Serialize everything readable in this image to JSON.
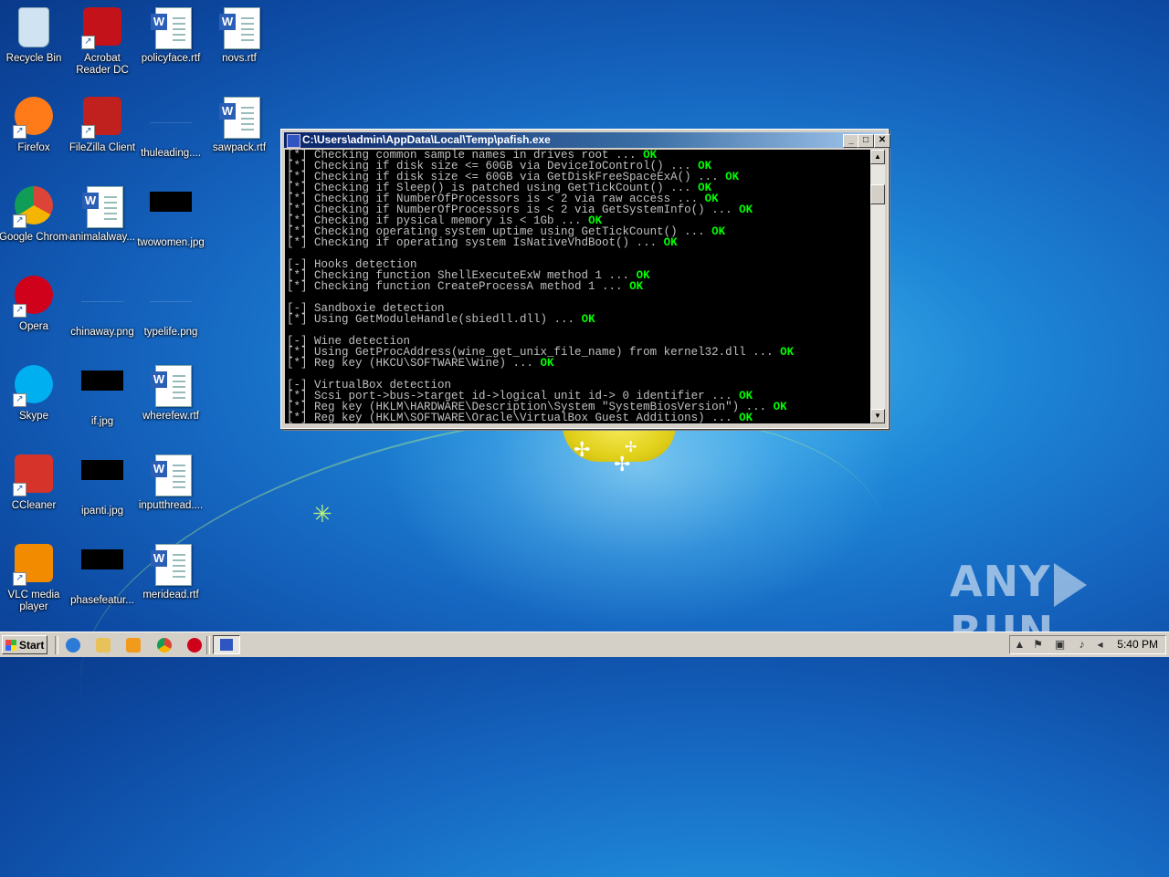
{
  "desktop": {
    "icons": [
      {
        "label": "Recycle Bin",
        "icon": "recycle-bin-icon"
      },
      {
        "label": "Acrobat Reader DC",
        "icon": "acrobat-icon"
      },
      {
        "label": "policyface.rtf",
        "icon": "word-document-icon"
      },
      {
        "label": "novs.rtf",
        "icon": "word-document-icon"
      },
      {
        "label": "Firefox",
        "icon": "firefox-icon"
      },
      {
        "label": "FileZilla Client",
        "icon": "filezilla-icon"
      },
      {
        "label": "thuleading....",
        "icon": "image-file-icon"
      },
      {
        "label": "sawpack.rtf",
        "icon": "word-document-icon"
      },
      {
        "label": "Google Chrome",
        "icon": "chrome-icon"
      },
      {
        "label": "animalalway...",
        "icon": "word-document-icon"
      },
      {
        "label": "twowomen.jpg",
        "icon": "image-file-icon"
      },
      {
        "label": "Opera",
        "icon": "opera-icon"
      },
      {
        "label": "chinaway.png",
        "icon": "image-file-icon"
      },
      {
        "label": "typelife.png",
        "icon": "image-file-icon"
      },
      {
        "label": "Skype",
        "icon": "skype-icon"
      },
      {
        "label": "if.jpg",
        "icon": "image-file-icon"
      },
      {
        "label": "wherefew.rtf",
        "icon": "word-document-icon"
      },
      {
        "label": "CCleaner",
        "icon": "ccleaner-icon"
      },
      {
        "label": "ipanti.jpg",
        "icon": "image-file-icon"
      },
      {
        "label": "inputthread....",
        "icon": "word-document-icon"
      },
      {
        "label": "VLC media player",
        "icon": "vlc-icon"
      },
      {
        "label": "phasefeatur...",
        "icon": "image-file-icon"
      },
      {
        "label": "meridead.rtf",
        "icon": "word-document-icon"
      }
    ]
  },
  "console": {
    "title": "C:\\Users\\admin\\AppData\\Local\\Temp\\pafish.exe",
    "lines": [
      {
        "text": "[*] Checking common sample names in drives root ... ",
        "status": "OK"
      },
      {
        "text": "[*] Checking if disk size <= 60GB via DeviceIoControl() ... ",
        "status": "OK"
      },
      {
        "text": "[*] Checking if disk size <= 60GB via GetDiskFreeSpaceExA() ... ",
        "status": "OK"
      },
      {
        "text": "[*] Checking if Sleep() is patched using GetTickCount() ... ",
        "status": "OK"
      },
      {
        "text": "[*] Checking if NumberOfProcessors is < 2 via raw access ... ",
        "status": "OK"
      },
      {
        "text": "[*] Checking if NumberOfProcessors is < 2 via GetSystemInfo() ... ",
        "status": "OK"
      },
      {
        "text": "[*] Checking if pysical memory is < 1Gb ... ",
        "status": "OK"
      },
      {
        "text": "[*] Checking operating system uptime using GetTickCount() ... ",
        "status": "OK"
      },
      {
        "text": "[*] Checking if operating system IsNativeVhdBoot() ... ",
        "status": "OK"
      },
      {
        "text": "",
        "status": ""
      },
      {
        "text": "[-] Hooks detection",
        "status": ""
      },
      {
        "text": "[*] Checking function ShellExecuteExW method 1 ... ",
        "status": "OK"
      },
      {
        "text": "[*] Checking function CreateProcessA method 1 ... ",
        "status": "OK"
      },
      {
        "text": "",
        "status": ""
      },
      {
        "text": "[-] Sandboxie detection",
        "status": ""
      },
      {
        "text": "[*] Using GetModuleHandle(sbiedll.dll) ... ",
        "status": "OK"
      },
      {
        "text": "",
        "status": ""
      },
      {
        "text": "[-] Wine detection",
        "status": ""
      },
      {
        "text": "[*] Using GetProcAddress(wine_get_unix_file_name) from kernel32.dll ... ",
        "status": "OK"
      },
      {
        "text": "[*] Reg key (HKCU\\SOFTWARE\\Wine) ... ",
        "status": "OK"
      },
      {
        "text": "",
        "status": ""
      },
      {
        "text": "[-] VirtualBox detection",
        "status": ""
      },
      {
        "text": "[*] Scsi port->bus->target id->logical unit id-> 0 identifier ... ",
        "status": "OK"
      },
      {
        "text": "[*] Reg key (HKLM\\HARDWARE\\Description\\System \"SystemBiosVersion\") ... ",
        "status": "OK"
      },
      {
        "text": "[*] Reg key (HKLM\\SOFTWARE\\Oracle\\VirtualBox Guest Additions) ... ",
        "status": "OK"
      }
    ]
  },
  "taskbar": {
    "start_label": "Start",
    "clock": "5:40 PM",
    "quick_launch": [
      "ie-icon",
      "explorer-folder-icon",
      "media-player-icon",
      "chrome-icon",
      "opera-icon"
    ]
  },
  "watermark": {
    "text_left": "ANY",
    "text_right": "RUN"
  },
  "colors": {
    "console_ok": "#00ff00",
    "console_text": "#c0c0c0",
    "titlebar": "#0a246a"
  }
}
